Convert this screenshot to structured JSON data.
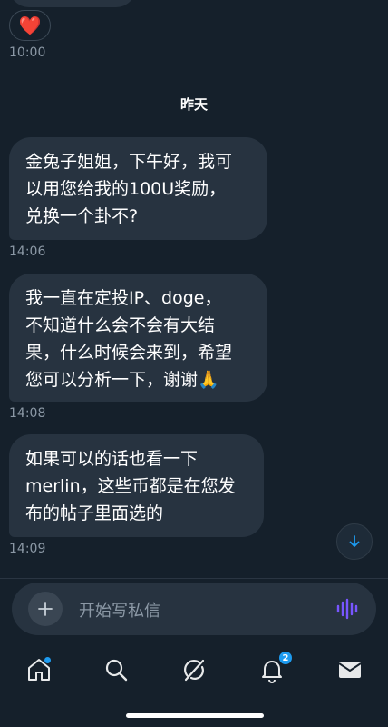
{
  "previous_message": {
    "reaction": "❤️",
    "time": "10:00"
  },
  "day_separator": "昨天",
  "messages": [
    {
      "text": "金兔子姐姐，下午好，我可\n以用您给我的100U奖励，\n兑换一个卦不?",
      "time": "14:06"
    },
    {
      "text": "我一直在定投IP、doge，\n不知道什么会不会有大结\n果，什么时候会来到，希望\n您可以分析一下，谢谢🙏",
      "time": "14:08"
    },
    {
      "text": "如果可以的话也看一下\nmerlin，这些币都是在您发\n布的帖子里面选的",
      "time": "14:09"
    }
  ],
  "composer": {
    "placeholder": "开始写私信"
  },
  "tabbar": {
    "notifications_badge": "2"
  },
  "colors": {
    "background": "#15202b",
    "bubble": "#273340",
    "accent": "#1d9bf0",
    "voice": "#7856ff"
  },
  "icons": [
    "heart-emoji",
    "arrow-down-icon",
    "plus-icon",
    "voice-waveform-icon",
    "home-icon",
    "search-icon",
    "grok-icon",
    "bell-icon",
    "mail-icon"
  ]
}
